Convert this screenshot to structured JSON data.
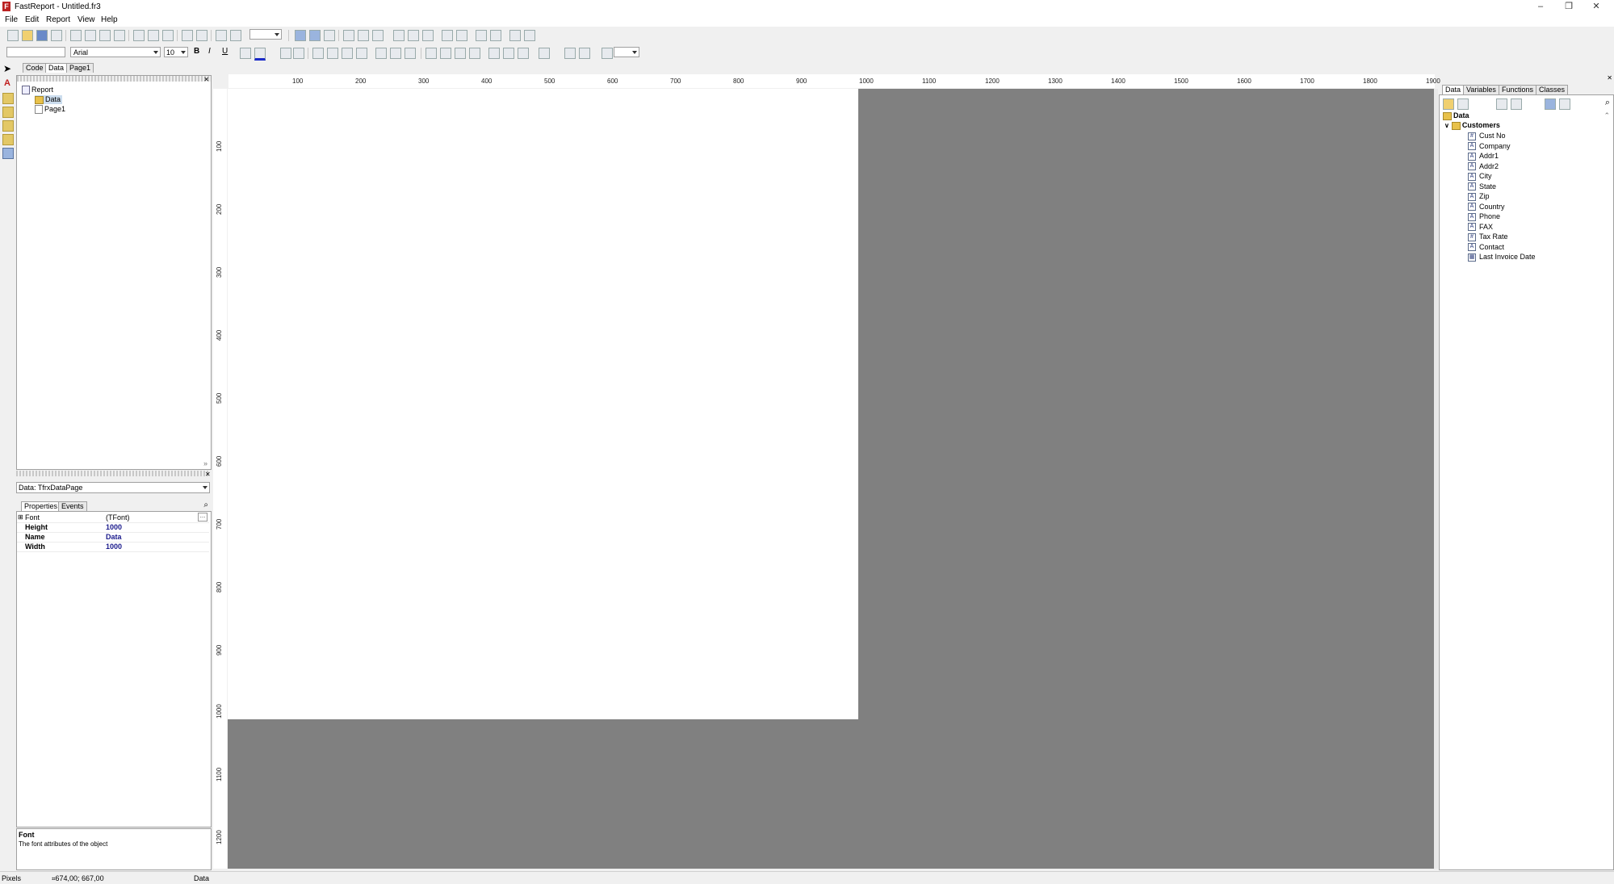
{
  "window": {
    "title": "FastReport - Untitled.fr3",
    "controls": [
      "–",
      "❐",
      "✕"
    ]
  },
  "menu": [
    "File",
    "Edit",
    "Report",
    "View",
    "Help"
  ],
  "format_toolbar": {
    "style_combo": "",
    "font_name": "Arial",
    "font_size": "10",
    "bold": "B",
    "italic": "I",
    "underline": "U"
  },
  "page_tabs": [
    "Code",
    "Data",
    "Page1"
  ],
  "report_tree": {
    "root": "Report",
    "children": [
      "Data",
      "Page1"
    ]
  },
  "object_selector": "Data: TfrxDataPage",
  "inspector": {
    "tabs": [
      "Properties",
      "Events"
    ],
    "rows": [
      {
        "name": "Font",
        "value": "(TFont)"
      },
      {
        "name": "Height",
        "value": "1000"
      },
      {
        "name": "Name",
        "value": "Data"
      },
      {
        "name": "Width",
        "value": "1000"
      }
    ],
    "help_title": "Font",
    "help_text": "The font attributes of the object"
  },
  "ruler": {
    "h_labels": [
      "100",
      "200",
      "300",
      "400",
      "500",
      "600",
      "700",
      "800",
      "900",
      "1000",
      "1100",
      "1200",
      "1300",
      "1400",
      "1500",
      "1600",
      "1700",
      "1800",
      "1900"
    ],
    "v_labels": [
      "100",
      "200",
      "300",
      "400",
      "500",
      "600",
      "700",
      "800",
      "900",
      "1000",
      "1100",
      "1200"
    ]
  },
  "data_tree": {
    "tabs": [
      "Data",
      "Variables",
      "Functions",
      "Classes"
    ],
    "root": "Data",
    "dataset": "Customers",
    "fields": [
      {
        "name": "Cust No",
        "icon": "numeric-field-icon"
      },
      {
        "name": "Company",
        "icon": "text-field-icon"
      },
      {
        "name": "Addr1",
        "icon": "text-field-icon"
      },
      {
        "name": "Addr2",
        "icon": "text-field-icon"
      },
      {
        "name": "City",
        "icon": "text-field-icon"
      },
      {
        "name": "State",
        "icon": "text-field-icon"
      },
      {
        "name": "Zip",
        "icon": "text-field-icon"
      },
      {
        "name": "Country",
        "icon": "text-field-icon"
      },
      {
        "name": "Phone",
        "icon": "text-field-icon"
      },
      {
        "name": "FAX",
        "icon": "text-field-icon"
      },
      {
        "name": "Tax Rate",
        "icon": "numeric-field-icon"
      },
      {
        "name": "Contact",
        "icon": "text-field-icon"
      },
      {
        "name": "Last Invoice Date",
        "icon": "date-field-icon"
      }
    ]
  },
  "status": {
    "units": "Pixels",
    "coords": "674,00; 667,00",
    "page": "Data"
  },
  "colors": {
    "workspace": "#808080",
    "page": "#ffffff",
    "accent_value": "#1a1a8c"
  }
}
